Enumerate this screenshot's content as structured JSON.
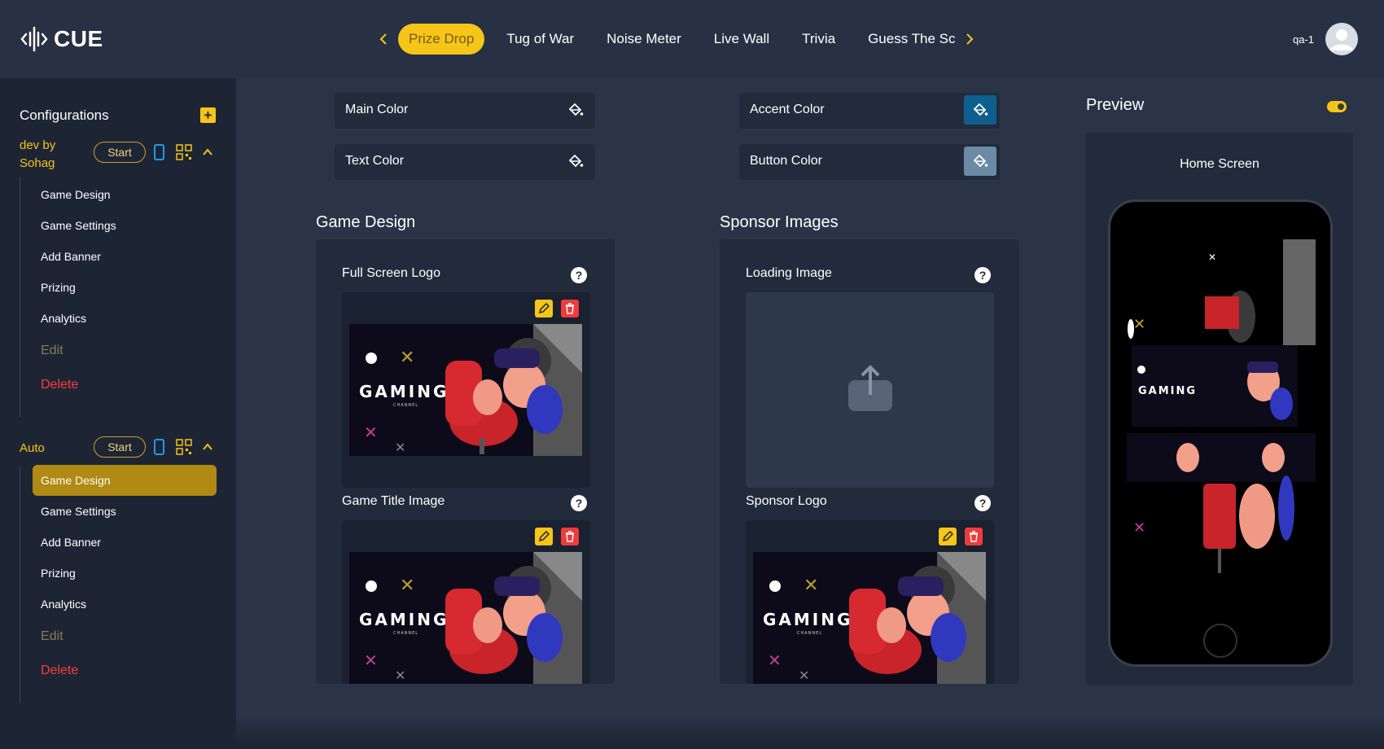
{
  "brand": {
    "name": "CUE",
    "accent": "#f5c518"
  },
  "tabs": {
    "prev_icon": "chevron-left-icon",
    "next_icon": "chevron-right-icon",
    "items": [
      {
        "label": "Prize Drop",
        "active": true
      },
      {
        "label": "Tug of War",
        "active": false
      },
      {
        "label": "Noise Meter",
        "active": false
      },
      {
        "label": "Live Wall",
        "active": false
      },
      {
        "label": "Trivia",
        "active": false
      },
      {
        "label": "Guess The Sc",
        "active": false
      }
    ]
  },
  "user": {
    "name": "qa-1",
    "avatar_icon": "user-avatar-icon"
  },
  "sidebar": {
    "title": "Configurations",
    "add_icon": "plus-icon",
    "configs": [
      {
        "name": "dev by Sohag",
        "start_label": "Start",
        "expanded": true,
        "items": [
          "Game Design",
          "Game Settings",
          "Add Banner",
          "Prizing",
          "Analytics"
        ],
        "edit_label": "Edit",
        "delete_label": "Delete"
      },
      {
        "name": "Auto",
        "start_label": "Start",
        "expanded": true,
        "active_item": "Game Design",
        "items": [
          "Game Design",
          "Game Settings",
          "Add Banner",
          "Prizing",
          "Analytics"
        ],
        "edit_label": "Edit",
        "delete_label": "Delete"
      }
    ]
  },
  "colors": {
    "main": {
      "label": "Main Color",
      "value": "#222b3b"
    },
    "text": {
      "label": "Text Color",
      "value": "#222b3b"
    },
    "accent": {
      "label": "Accent Color",
      "value": "#0f5f8e"
    },
    "button": {
      "label": "Button Color",
      "value": "#6a8aa5"
    }
  },
  "game_design": {
    "title": "Game Design",
    "full_screen_logo": "Full Screen Logo",
    "game_title_image": "Game Title Image"
  },
  "sponsor_images": {
    "title": "Sponsor Images",
    "loading_image": "Loading Image",
    "sponsor_logo": "Sponsor Logo"
  },
  "gaming_image": {
    "text": "GAMING",
    "subtext": "CHANNEL"
  },
  "preview": {
    "title": "Preview",
    "screen": "Home Screen",
    "toggle_on": true
  }
}
